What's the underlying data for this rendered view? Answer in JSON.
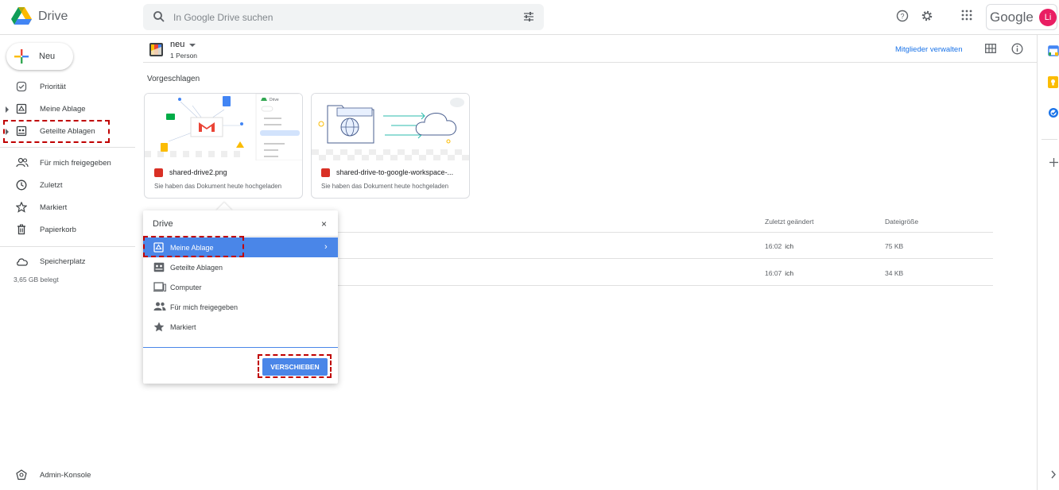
{
  "app": {
    "name": "Drive"
  },
  "search": {
    "placeholder": "In Google Drive suchen"
  },
  "account": {
    "brand": "Google",
    "initials": "Li"
  },
  "sidebar": {
    "new_label": "Neu",
    "items": [
      {
        "label": "Priorität",
        "icon": "priority-icon"
      },
      {
        "label": "Meine Ablage",
        "icon": "my-drive-icon"
      },
      {
        "label": "Geteilte Ablagen",
        "icon": "shared-drives-icon"
      },
      {
        "label": "Für mich freigegeben",
        "icon": "shared-with-me-icon"
      },
      {
        "label": "Zuletzt",
        "icon": "clock-icon"
      },
      {
        "label": "Markiert",
        "icon": "star-icon"
      },
      {
        "label": "Papierkorb",
        "icon": "trash-icon"
      }
    ],
    "storage_label": "Speicherplatz",
    "storage_used": "3,65 GB belegt",
    "admin_label": "Admin-Konsole"
  },
  "header": {
    "title": "neu",
    "members": "1 Person",
    "manage_members": "Mitglieder verwalten"
  },
  "suggested": {
    "title": "Vorgeschlagen",
    "cards": [
      {
        "name": "shared-drive2.png",
        "sub": "Sie haben das Dokument heute hochgeladen"
      },
      {
        "name": "shared-drive-to-google-workspace-...",
        "sub": "Sie haben das Dokument heute hochgeladen"
      }
    ]
  },
  "list": {
    "columns": {
      "modified": "Zuletzt geändert",
      "size": "Dateigröße"
    },
    "rows": [
      {
        "modified": "16:02",
        "by": "ich",
        "size": "75 KB"
      },
      {
        "modified": "16:07",
        "by": "ich",
        "size": "34 KB"
      }
    ]
  },
  "dialog": {
    "title": "Drive",
    "close": "×",
    "items": [
      {
        "label": "Meine Ablage",
        "icon": "my-drive-icon",
        "selected": true
      },
      {
        "label": "Geteilte Ablagen",
        "icon": "shared-drives-icon"
      },
      {
        "label": "Computer",
        "icon": "computer-icon"
      },
      {
        "label": "Für mich freigegeben",
        "icon": "shared-with-me-icon"
      },
      {
        "label": "Markiert",
        "icon": "star-icon"
      }
    ],
    "move_button": "VERSCHIEBEN"
  },
  "colors": {
    "accent": "#1a73e8",
    "selection": "#4a86e8",
    "highlight": "#c00000"
  }
}
